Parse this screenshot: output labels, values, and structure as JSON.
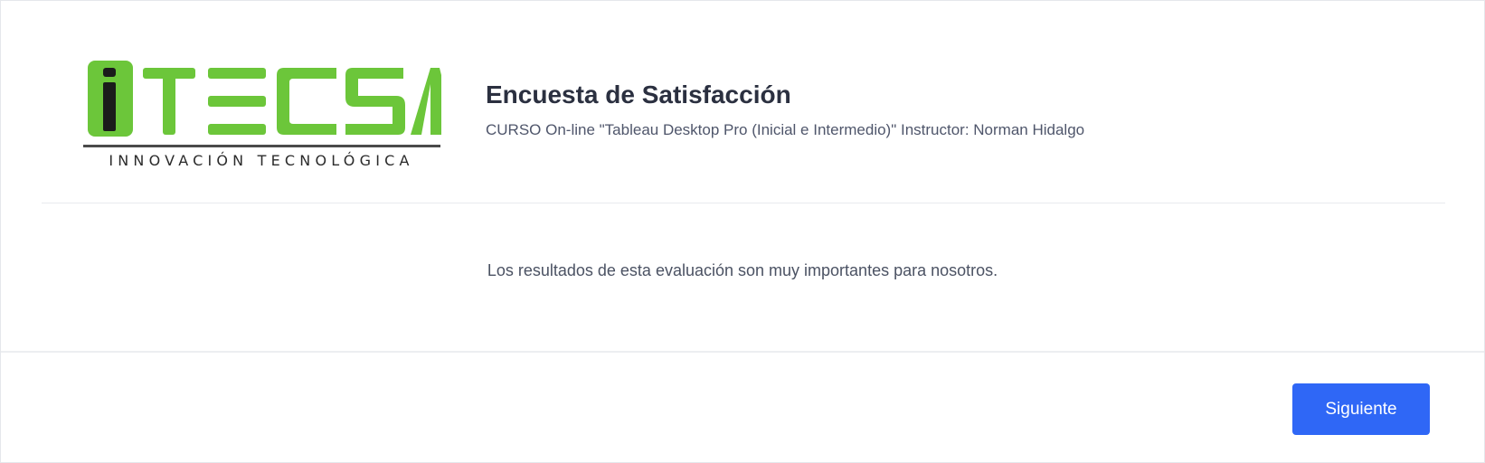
{
  "logo": {
    "wordmark": "iTECSA",
    "tagline": "INNOVACIÓN TECNOLÓGICA",
    "brand_color": "#6cc63a",
    "dark_color": "#2b2b2b"
  },
  "header": {
    "title": "Encuesta de Satisfacción",
    "subtitle": "CURSO On-line \"Tableau Desktop Pro (Inicial e Intermedio)\" Instructor: Norman Hidalgo"
  },
  "body": {
    "message": "Los resultados de esta evaluación son muy importantes para nosotros."
  },
  "footer": {
    "next_label": "Siguiente",
    "button_color": "#2f67f6"
  }
}
